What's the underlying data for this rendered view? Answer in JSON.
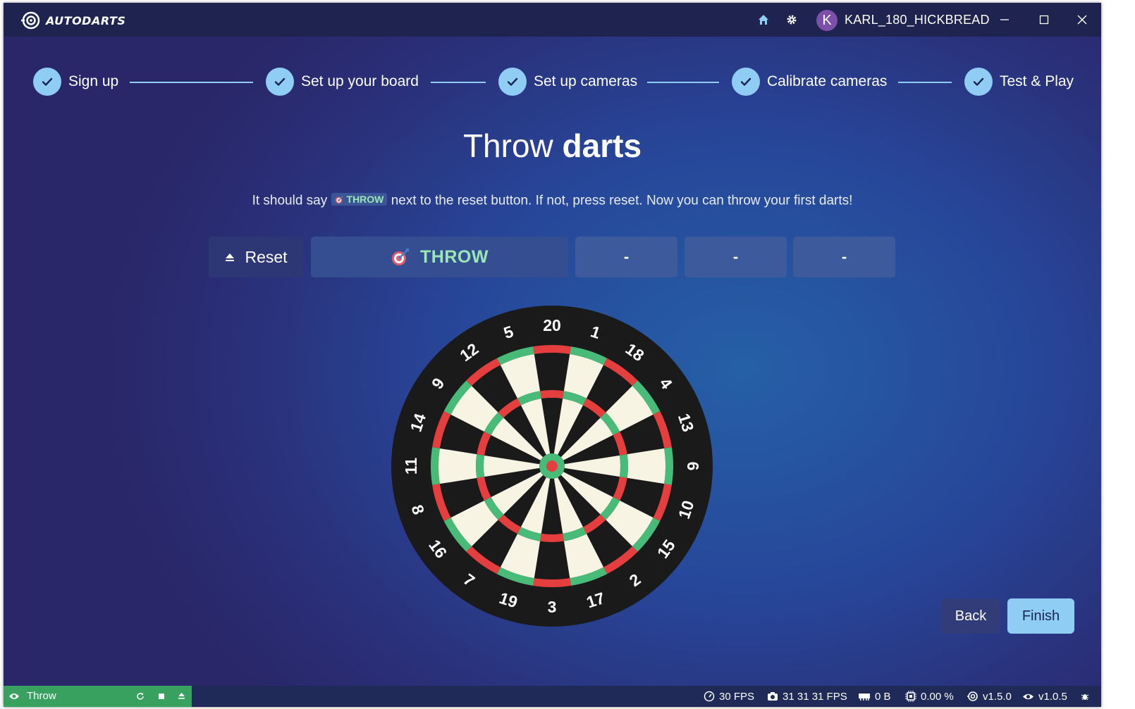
{
  "app": {
    "logo_text": "AUTODARTS",
    "username": "KARL_180_HICKBREAD",
    "avatar_letter": "K"
  },
  "steps": [
    {
      "label": "Sign up",
      "done": true
    },
    {
      "label": "Set up your board",
      "done": true
    },
    {
      "label": "Set up cameras",
      "done": true
    },
    {
      "label": "Calibrate cameras",
      "done": true
    },
    {
      "label": "Test & Play",
      "done": true
    }
  ],
  "heading": {
    "light": "Throw ",
    "bold": "darts"
  },
  "subtitle": {
    "before": "It should say ",
    "chip": "THROW",
    "after": " next to the reset button. If not, press reset. Now you can throw your first darts!"
  },
  "controls": {
    "reset_label": "Reset",
    "throw_label": "THROW",
    "slots": [
      "-",
      "-",
      "-"
    ]
  },
  "board": {
    "numbers": [
      20,
      1,
      18,
      4,
      13,
      6,
      10,
      15,
      2,
      17,
      3,
      19,
      7,
      16,
      8,
      11,
      14,
      9,
      12,
      5
    ]
  },
  "footer": {
    "back_label": "Back",
    "finish_label": "Finish"
  },
  "statusbar": {
    "mode": "Throw",
    "fps": "30 FPS",
    "camera_fps": "31 31 31 FPS",
    "memory": "0 B",
    "cpu": "0.00 %",
    "board_version": "v1.5.0",
    "vision_version": "v1.0.5"
  },
  "colors": {
    "accent": "#90cdf4",
    "green": "#9ae6b4",
    "board_red": "#e53e3e",
    "board_green": "#48bb78",
    "board_black": "#1a1a1a",
    "board_cream": "#f8f4e3",
    "status_green": "#38a160"
  }
}
